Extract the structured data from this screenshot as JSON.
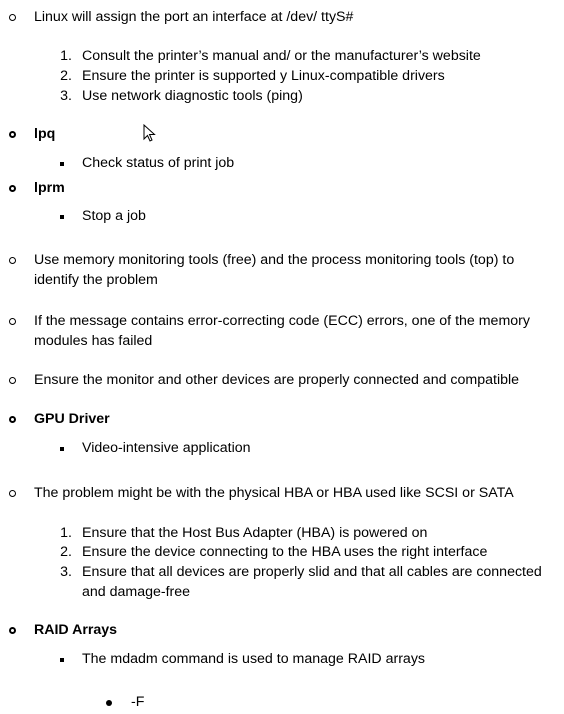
{
  "items": {
    "tty": "Linux will assign the port an interface at /dev/ ttyS#",
    "tty_steps": [
      {
        "n": "1.",
        "text": "Consult the printer’s manual and/ or the manufacturer’s website"
      },
      {
        "n": "2.",
        "text": "Ensure the printer is supported y Linux-compatible drivers"
      },
      {
        "n": "3.",
        "text": "Use network diagnostic tools (ping)"
      }
    ],
    "lpq": "lpq",
    "lpq_sub": "Check status of print job",
    "lprm": "lprm",
    "lprm_sub": "Stop a job",
    "memory": "Use memory monitoring tools (free) and the process monitoring tools (top) to identify the problem",
    "ecc": "If the message contains error-correcting code (ECC) errors, one of the memory modules has failed",
    "monitor": "Ensure the monitor and other devices are properly connected and compatible",
    "gpu": "GPU Driver",
    "gpu_sub": "Video-intensive application",
    "hba": "The problem might be with the physical HBA or HBA used like SCSI or SATA",
    "hba_steps": [
      {
        "n": "1.",
        "text": "Ensure that the Host Bus Adapter (HBA) is powered on"
      },
      {
        "n": "2.",
        "text": "Ensure the device connecting to the HBA uses the right interface"
      },
      {
        "n": "3.",
        "text": "Ensure that all devices are properly slid and that all cables are connected and damage-free"
      }
    ],
    "raid": "RAID Arrays",
    "raid_sub": "The mdadm command is used to manage RAID arrays",
    "raid_option": "-F"
  }
}
